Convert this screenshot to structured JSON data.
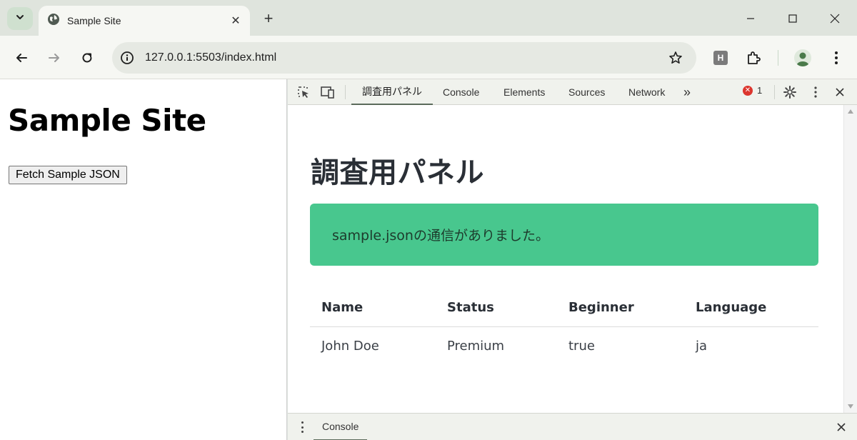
{
  "browser": {
    "tab_title": "Sample Site",
    "tab_close": "✕",
    "new_tab": "+",
    "url": "127.0.0.1:5503/index.html",
    "extension_h": "H"
  },
  "page": {
    "heading": "Sample Site",
    "fetch_button": "Fetch Sample JSON"
  },
  "devtools": {
    "tabs": [
      "調査用パネル",
      "Console",
      "Elements",
      "Sources",
      "Network"
    ],
    "more_tabs": "»",
    "error_count": "1",
    "active_tab_index": 0,
    "panel": {
      "title": "調査用パネル",
      "notice": "sample.jsonの通信がありました。",
      "notice_color": "#48c78e",
      "table": {
        "headers": [
          "Name",
          "Status",
          "Beginner",
          "Language"
        ],
        "rows": [
          [
            "John Doe",
            "Premium",
            "true",
            "ja"
          ]
        ]
      }
    },
    "drawer": {
      "tab": "Console"
    }
  }
}
